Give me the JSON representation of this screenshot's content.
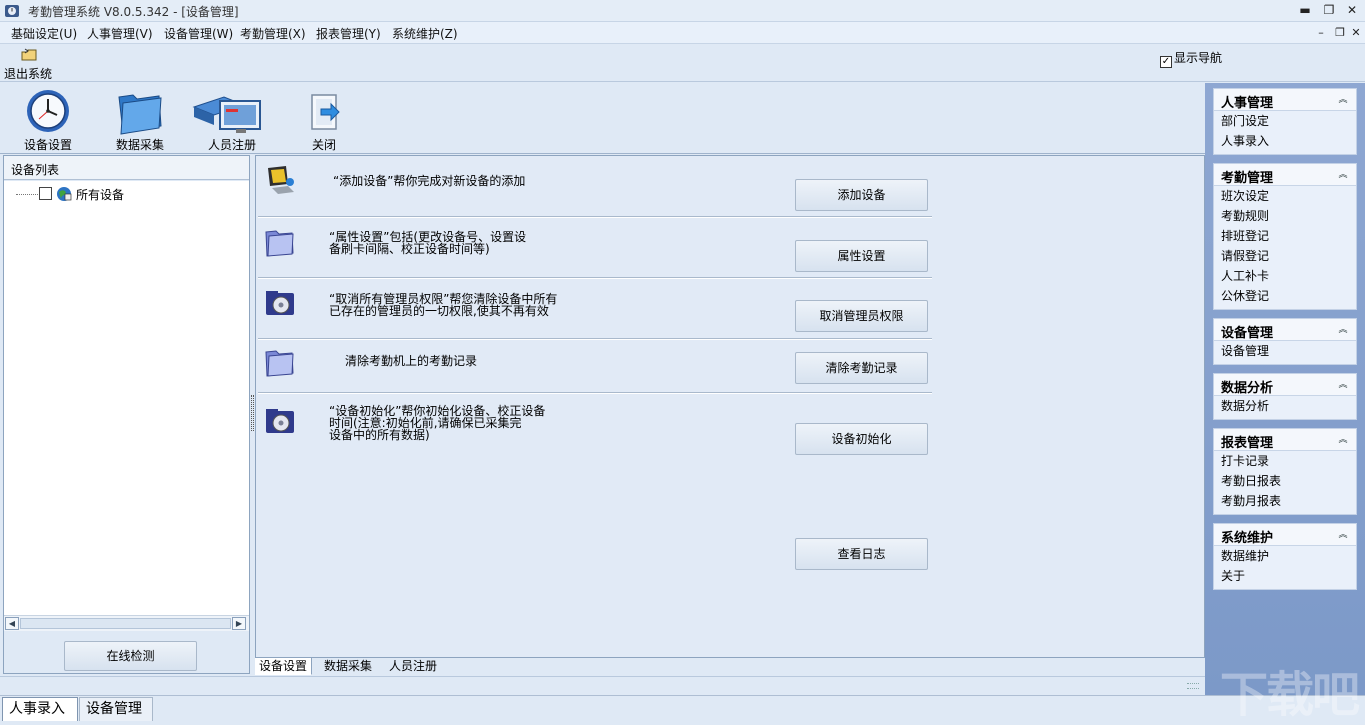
{
  "titlebar": {
    "title": "考勤管理系统 V8.0.5.342 - [设备管理]",
    "minimize": "▬",
    "restore": "❐",
    "close": "✕"
  },
  "menubar": {
    "items": [
      "基础设定(U)",
      "人事管理(V)",
      "设备管理(W)",
      "考勤管理(X)",
      "报表管理(Y)",
      "系统维护(Z)"
    ],
    "mdi_minimize": "–",
    "mdi_restore": "❐",
    "mdi_close": "✕"
  },
  "quickbar": {
    "exit_label": "退出系统",
    "show_nav_label": "显示导航",
    "show_nav_checked": true
  },
  "toolbar": {
    "items": [
      {
        "label": "设备设置",
        "icon": "clock-icon"
      },
      {
        "label": "数据采集",
        "icon": "folder-icon"
      },
      {
        "label": "人员注册",
        "icon": "user-register-icon"
      },
      {
        "label": "关闭",
        "icon": "close-door-icon"
      }
    ]
  },
  "device_list": {
    "header": "设备列表",
    "root_label": "所有设备",
    "root_checked": false,
    "online_button": "在线检测"
  },
  "main": {
    "rows": [
      {
        "desc": "“添加设备”帮你完成对新设备的添加",
        "button": "添加设备",
        "icon": "computer-icon"
      },
      {
        "desc": "“属性设置”包括(更改设备号、设置设\n备刷卡间隔、校正设备时间等)",
        "button": "属性设置",
        "icon": "folder-icon"
      },
      {
        "desc": "“取消所有管理员权限”帮您清除设备中所有\n已存在的管理员的一切权限,使其不再有效",
        "button": "取消管理员权限",
        "icon": "disk-icon"
      },
      {
        "desc": "清除考勤机上的考勤记录",
        "button": "清除考勤记录",
        "icon": "folder-icon"
      },
      {
        "desc": "“设备初始化”帮你初始化设备、校正设备\n时间(注意:初始化前,请确保已采集完\n设备中的所有数据)",
        "button": "设备初始化",
        "icon": "disk-icon"
      }
    ],
    "log_button": "查看日志",
    "tabs": [
      "设备设置",
      "数据采集",
      "人员注册"
    ]
  },
  "window_tabs": [
    "人事录入",
    "设备管理"
  ],
  "nav": {
    "groups": [
      {
        "title": "人事管理",
        "items": [
          "部门设定",
          "人事录入"
        ]
      },
      {
        "title": "考勤管理",
        "items": [
          "班次设定",
          "考勤规则",
          "排班登记",
          "请假登记",
          "人工补卡",
          "公休登记"
        ]
      },
      {
        "title": "设备管理",
        "items": [
          "设备管理"
        ]
      },
      {
        "title": "数据分析",
        "items": [
          "数据分析"
        ]
      },
      {
        "title": "报表管理",
        "items": [
          "打卡记录",
          "考勤日报表",
          "考勤月报表"
        ]
      },
      {
        "title": "系统维护",
        "items": [
          "数据维护",
          "关于"
        ]
      }
    ],
    "collapse_glyph": "︽"
  },
  "watermark": "下载吧",
  "colors": {
    "background": "#dfe9f5",
    "nav_panel": "#8ea7d2",
    "panel_border": "#8da4bf"
  }
}
